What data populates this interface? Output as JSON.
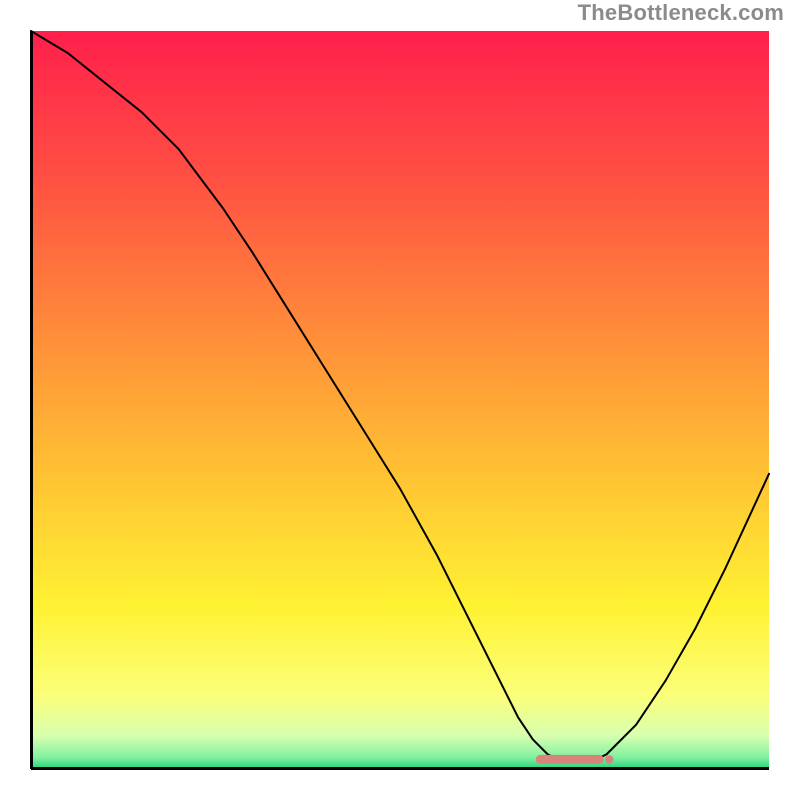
{
  "watermark": "TheBottleneck.com",
  "chart_data": {
    "type": "line",
    "title": "",
    "xlabel": "",
    "ylabel": "",
    "xlim": [
      0,
      100
    ],
    "ylim": [
      0,
      100
    ],
    "grid": false,
    "legend": false,
    "series": [
      {
        "name": "curve",
        "x": [
          0,
          5,
          10,
          15,
          20,
          23,
          26,
          30,
          35,
          40,
          45,
          50,
          55,
          58,
          60,
          62,
          64,
          66,
          68,
          70,
          72,
          74,
          76,
          78,
          82,
          86,
          90,
          94,
          100
        ],
        "y": [
          100,
          97,
          93,
          89,
          84,
          80,
          76,
          70,
          62,
          54,
          46,
          38,
          29,
          23,
          19,
          15,
          11,
          7,
          4,
          2,
          1,
          1,
          1,
          2,
          6,
          12,
          19,
          27,
          40
        ]
      }
    ],
    "marker": {
      "name": "optimal-band",
      "x_start": 69,
      "x_end": 77,
      "y": 1.3,
      "color": "#d9837a"
    },
    "background_gradient_stops": [
      {
        "offset": 0.0,
        "color": "#ff1f4c"
      },
      {
        "offset": 0.2,
        "color": "#ff5043"
      },
      {
        "offset": 0.4,
        "color": "#ff8a3a"
      },
      {
        "offset": 0.6,
        "color": "#ffc233"
      },
      {
        "offset": 0.78,
        "color": "#fff233"
      },
      {
        "offset": 0.9,
        "color": "#fbff7a"
      },
      {
        "offset": 0.955,
        "color": "#d8ffb0"
      },
      {
        "offset": 0.985,
        "color": "#7ff0a0"
      },
      {
        "offset": 1.0,
        "color": "#1fd27a"
      }
    ],
    "axes_color": "#000000",
    "line_color": "#000000",
    "line_width": 2
  }
}
